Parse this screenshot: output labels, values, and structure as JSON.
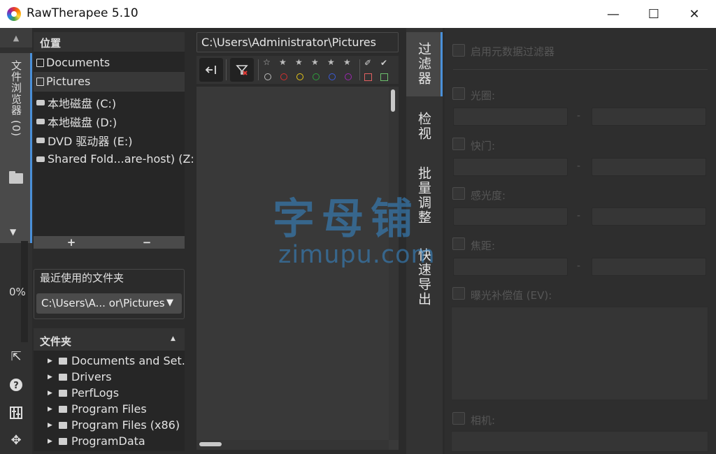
{
  "window": {
    "title": "RawTherapee 5.10",
    "minimize": "—",
    "maximize": "☐",
    "close": "✕"
  },
  "left_strip": {
    "tab_label": "文件浏览器 (0)",
    "progress": "0%"
  },
  "places": {
    "header": "位置",
    "items": [
      {
        "label": "Documents",
        "icon": "document-icon"
      },
      {
        "label": "Pictures",
        "icon": "image-icon"
      },
      {
        "label": "本地磁盘 (C:)",
        "icon": "drive-icon"
      },
      {
        "label": "本地磁盘 (D:)",
        "icon": "drive-icon"
      },
      {
        "label": "DVD 驱动器 (E:)",
        "icon": "dvd-icon"
      },
      {
        "label": "Shared Fold...are-host) (Z:)",
        "icon": "network-drive-icon"
      }
    ],
    "add_label": "+",
    "remove_label": "−"
  },
  "recent": {
    "label": "最近使用的文件夹",
    "value": "C:\\Users\\A... or\\Pictures"
  },
  "folders": {
    "header": "文件夹",
    "items": [
      "Documents and Set...",
      "Drivers",
      "PerfLogs",
      "Program Files",
      "Program Files (x86)",
      "ProgramData"
    ]
  },
  "browser": {
    "path": "C:\\Users\\Administrator\\Pictures"
  },
  "right_tabs": {
    "filter": "过滤器",
    "inspect": "检视",
    "batch": "批量调整",
    "export": "快速导出"
  },
  "filter_panel": {
    "enable_metadata": "启用元数据过滤器",
    "aperture": "光圈:",
    "shutter": "快门:",
    "iso": "感光度:",
    "focal": "焦距:",
    "ev": "曝光补偿值 (EV):",
    "camera": "相机:",
    "dash": "-"
  },
  "watermark": {
    "cn": "字母铺",
    "en": "zimupu.com"
  },
  "colors": {
    "accent": "#4a90d9",
    "panel": "#262626",
    "background": "#2b2b2b"
  }
}
